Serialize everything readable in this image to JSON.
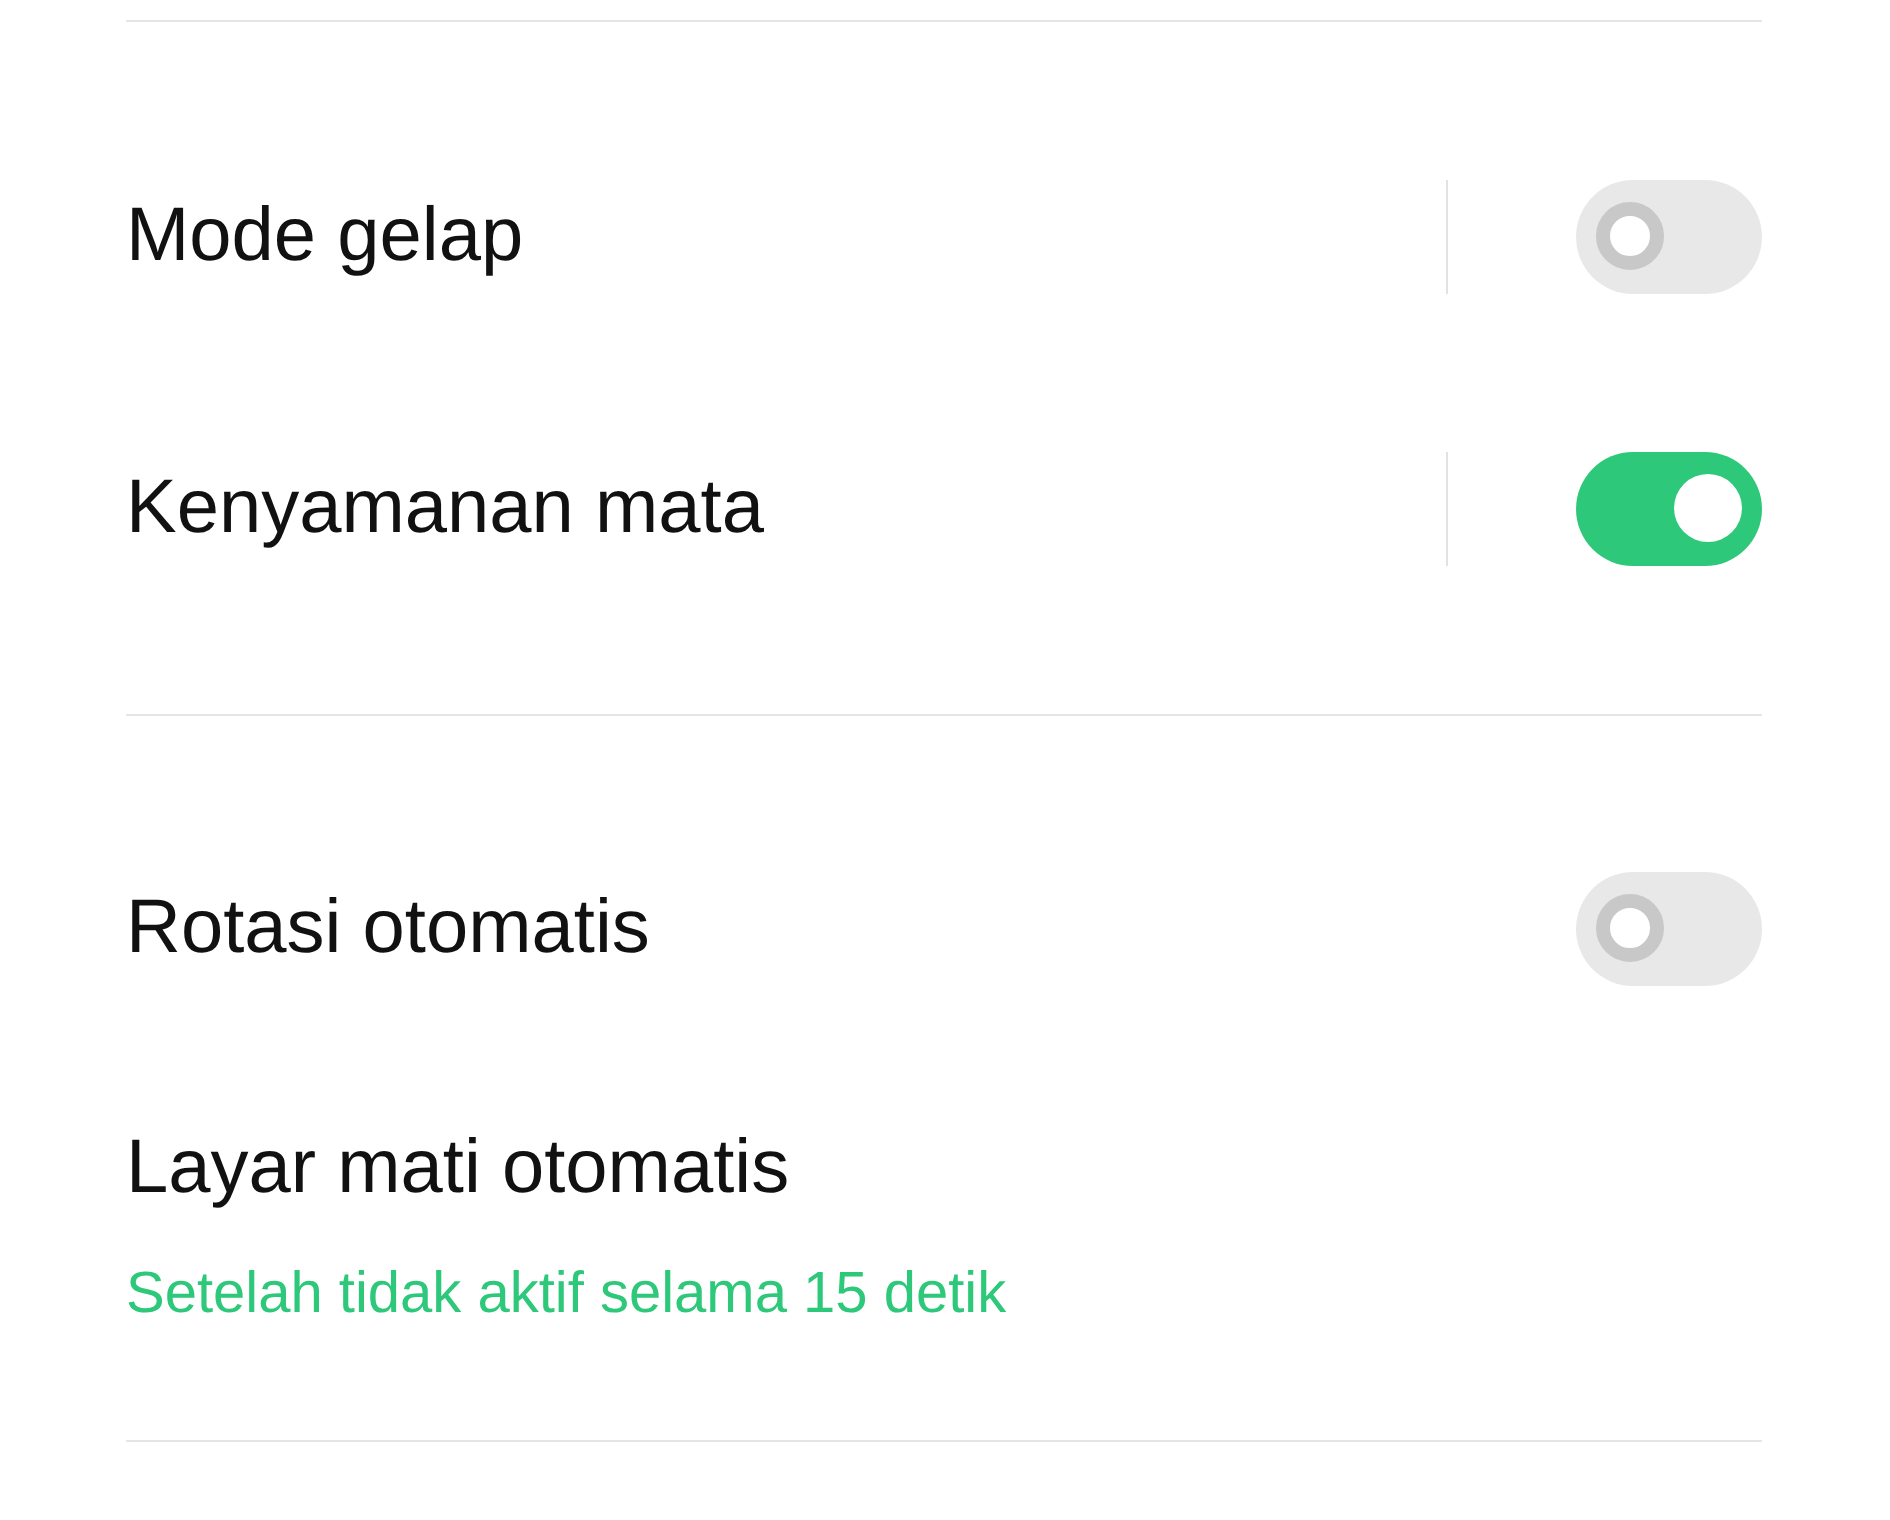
{
  "groups": [
    {
      "items": [
        {
          "kind": "toggle",
          "label": "Mode gelap",
          "on": false,
          "separator": true
        },
        {
          "kind": "toggle",
          "label": "Kenyamanan mata",
          "on": true,
          "separator": true
        }
      ]
    },
    {
      "items": [
        {
          "kind": "toggle",
          "label": "Rotasi otomatis",
          "on": false,
          "separator": false
        },
        {
          "kind": "info",
          "label": "Layar mati otomatis",
          "subtitle": "Setelah tidak aktif selama 15 detik"
        }
      ]
    }
  ]
}
